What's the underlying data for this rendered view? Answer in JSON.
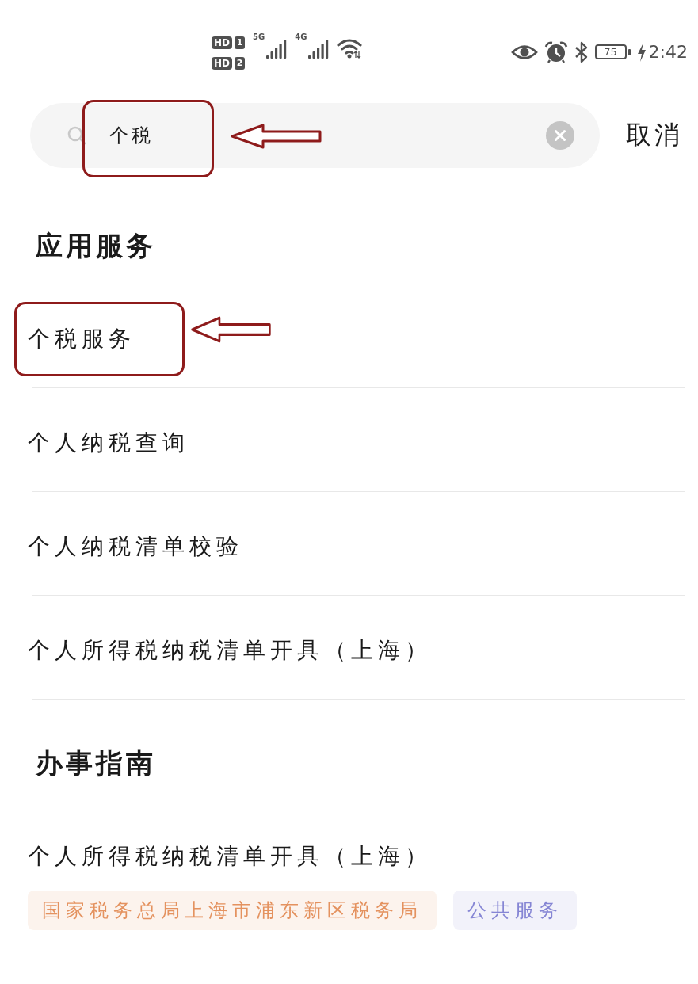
{
  "status_bar": {
    "sim_badges": [
      {
        "label": "HD",
        "slot": "1"
      },
      {
        "label": "HD",
        "slot": "2"
      }
    ],
    "networks": [
      {
        "label": "5G"
      },
      {
        "label": "4G"
      }
    ],
    "battery": "75",
    "charging": true,
    "time": "2:42"
  },
  "search": {
    "value": "个税",
    "annotated": true,
    "cancel": "取消"
  },
  "sections": [
    {
      "title": "应用服务",
      "items": [
        {
          "label": "个税服务",
          "annotated": true
        },
        {
          "label": "个人纳税查询",
          "annotated": false
        },
        {
          "label": "个人纳税清单校验",
          "annotated": false
        },
        {
          "label": "个人所得税纳税清单开具（上海）",
          "annotated": false
        }
      ]
    },
    {
      "title": "办事指南",
      "items": [
        {
          "label": "个人所得税纳税清单开具（上海）",
          "annotated": false,
          "tags": [
            {
              "label": "国家税务总局上海市浦东新区税务局",
              "color": "#e4925f"
            },
            {
              "label": "公共服务",
              "color": "#8585d4"
            }
          ]
        }
      ]
    }
  ]
}
